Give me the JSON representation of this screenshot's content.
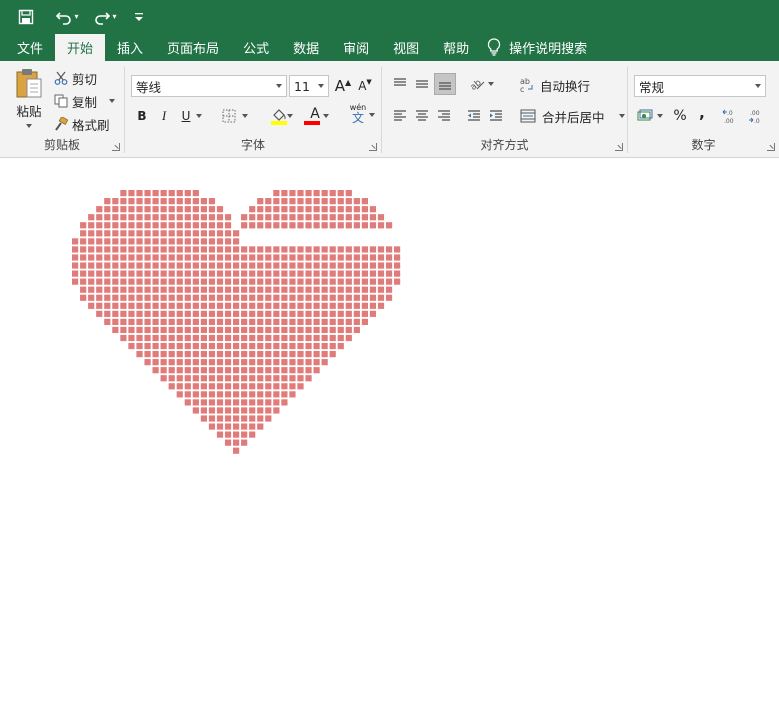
{
  "qat": {
    "save_icon": "save-icon",
    "undo_icon": "undo-icon",
    "redo_icon": "redo-icon",
    "customize_icon": "customize-qat-icon"
  },
  "tabs": [
    {
      "label": "文件"
    },
    {
      "label": "开始"
    },
    {
      "label": "插入"
    },
    {
      "label": "页面布局"
    },
    {
      "label": "公式"
    },
    {
      "label": "数据"
    },
    {
      "label": "审阅"
    },
    {
      "label": "视图"
    },
    {
      "label": "帮助"
    }
  ],
  "tell_me": {
    "label": "操作说明搜索",
    "icon": "lightbulb-icon"
  },
  "clipboard": {
    "paste": "粘贴",
    "cut": "剪切",
    "copy": "复制",
    "format_painter": "格式刷",
    "group_label": "剪贴板"
  },
  "font": {
    "name": "等线",
    "size": "11",
    "bold": "B",
    "italic": "I",
    "underline": "U",
    "grow": "A",
    "shrink": "A",
    "font_color_letter": "A",
    "phonetic": "wén",
    "phonetic_char": "文",
    "group_label": "字体"
  },
  "alignment": {
    "wrap_text": "自动换行",
    "merge_center": "合并后居中",
    "group_label": "对齐方式"
  },
  "number": {
    "format": "常规",
    "percent": "%",
    "comma": ",",
    "group_label": "数字"
  },
  "colors": {
    "ribbon_green": "#217346",
    "ribbon_bg": "#f3f3f3",
    "heart_cell": "#e07b7b",
    "fill_highlight": "#ffff00",
    "font_red": "#ff0000"
  },
  "heart": {
    "row_spans": [
      [
        6,
        15,
        25,
        34
      ],
      [
        4,
        17,
        23,
        36
      ],
      [
        3,
        18,
        22,
        37
      ],
      [
        2,
        19,
        21,
        38
      ],
      [
        1,
        19,
        21,
        39
      ],
      [
        1,
        20,
        40
      ],
      [
        0,
        20,
        40
      ],
      [
        0,
        40
      ],
      [
        0,
        40
      ],
      [
        0,
        40
      ],
      [
        0,
        40
      ],
      [
        0,
        40
      ],
      [
        1,
        39
      ],
      [
        1,
        39
      ],
      [
        2,
        38
      ],
      [
        3,
        37
      ],
      [
        4,
        36
      ],
      [
        5,
        35
      ],
      [
        6,
        34
      ],
      [
        7,
        33
      ],
      [
        8,
        32
      ],
      [
        9,
        31
      ],
      [
        10,
        30
      ],
      [
        11,
        29
      ],
      [
        12,
        28
      ],
      [
        13,
        27
      ],
      [
        14,
        26
      ],
      [
        15,
        25
      ],
      [
        16,
        24
      ],
      [
        17,
        23
      ],
      [
        18,
        22
      ],
      [
        19,
        21
      ],
      [
        20,
        20
      ]
    ]
  }
}
